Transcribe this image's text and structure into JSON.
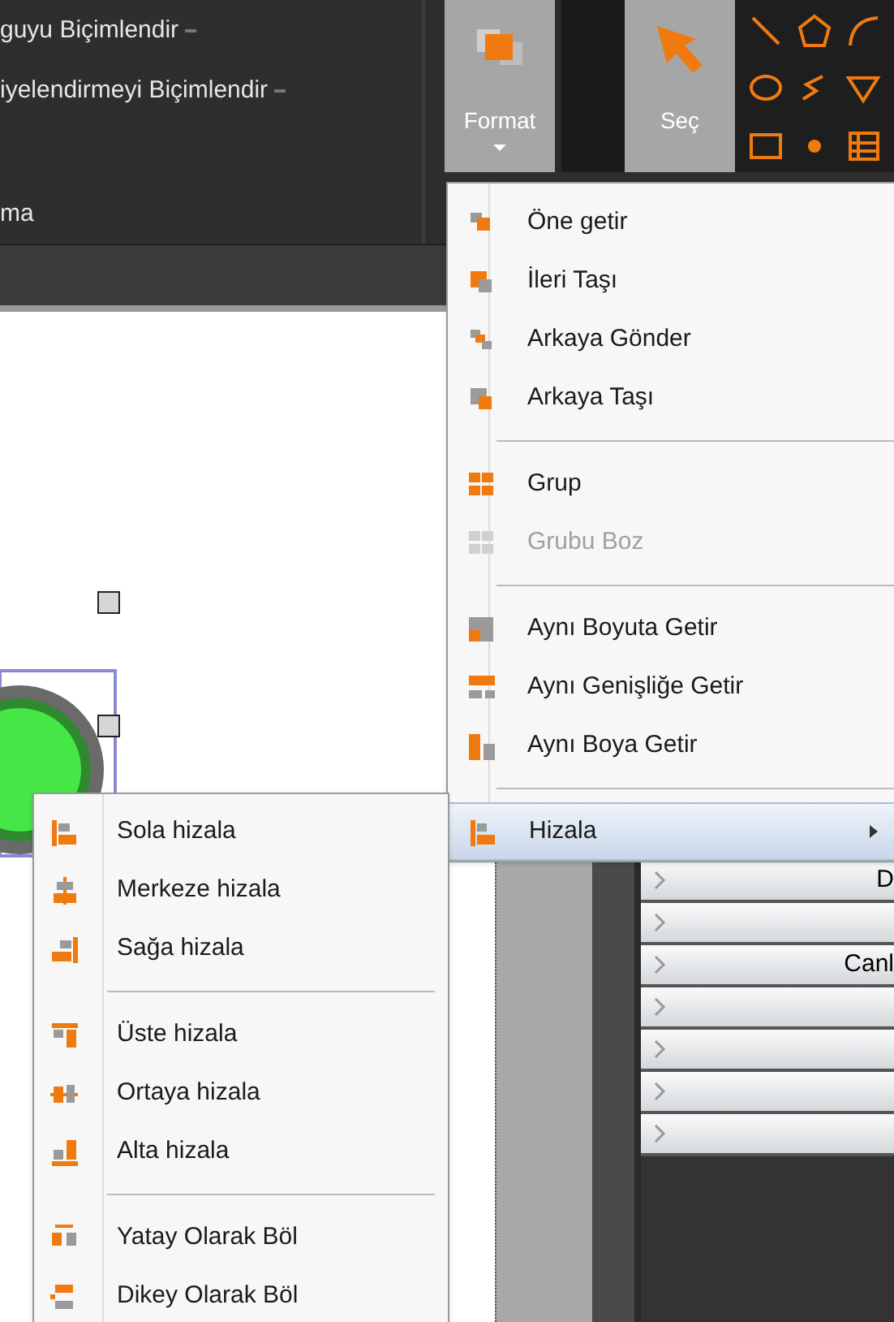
{
  "ribbon": {
    "left_group": [
      {
        "label": "guyu Biçimlendir",
        "has_dropdown": true
      },
      {
        "label": "iyelendirmeyi Biçimlendir",
        "has_dropdown": true
      },
      {
        "label": "ma",
        "has_dropdown": false
      }
    ],
    "buttons": [
      {
        "kind": "format",
        "label": "Format",
        "has_menu": true
      },
      {
        "kind": "select",
        "label": "Seç",
        "has_menu": false
      }
    ]
  },
  "format_menu": {
    "groups": [
      [
        {
          "label": "Öne getir",
          "disabled": false,
          "selected": false,
          "submenu": false
        },
        {
          "label": "İleri Taşı",
          "disabled": false,
          "selected": false,
          "submenu": false
        },
        {
          "label": "Arkaya Gönder",
          "disabled": false,
          "selected": false,
          "submenu": false
        },
        {
          "label": "Arkaya Taşı",
          "disabled": false,
          "selected": false,
          "submenu": false
        }
      ],
      [
        {
          "label": "Grup",
          "disabled": false,
          "selected": false,
          "submenu": false
        },
        {
          "label": "Grubu Boz",
          "disabled": true,
          "selected": false,
          "submenu": false
        }
      ],
      [
        {
          "label": "Aynı Boyuta Getir",
          "disabled": false,
          "selected": false,
          "submenu": false
        },
        {
          "label": "Aynı Genişliğe Getir",
          "disabled": false,
          "selected": false,
          "submenu": false
        },
        {
          "label": "Aynı Boya Getir",
          "disabled": false,
          "selected": false,
          "submenu": false
        }
      ],
      [
        {
          "label": "Hizala",
          "disabled": false,
          "selected": true,
          "submenu": true
        }
      ]
    ]
  },
  "align_submenu": {
    "groups": [
      [
        {
          "label": "Sola hizala"
        },
        {
          "label": "Merkeze hizala"
        },
        {
          "label": "Sağa hizala"
        }
      ],
      [
        {
          "label": "Üste hizala"
        },
        {
          "label": "Ortaya hizala"
        },
        {
          "label": "Alta hizala"
        }
      ],
      [
        {
          "label": "Yatay Olarak Böl"
        },
        {
          "label": "Dikey Olarak Böl"
        }
      ]
    ]
  },
  "list_panel": {
    "rows": [
      {
        "label": "D"
      },
      {},
      {
        "label": "Canl"
      },
      {},
      {},
      {},
      {}
    ]
  }
}
